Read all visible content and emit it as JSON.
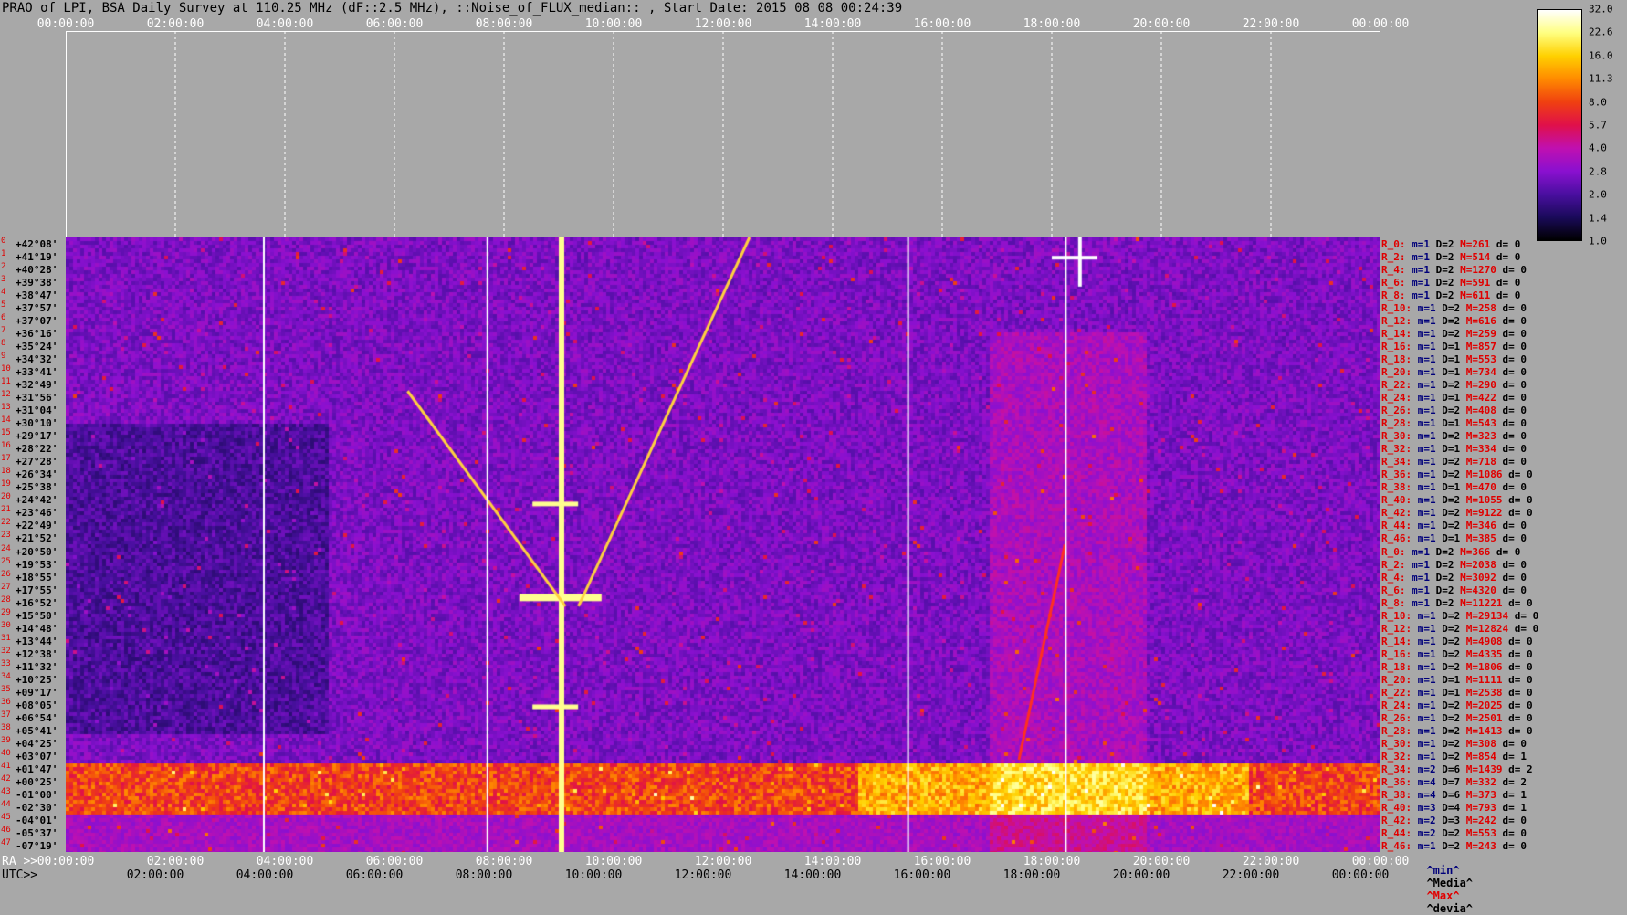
{
  "title": "PRAO of LPI, BSA Daily Survey at 110.25 MHz (dF::2.5 MHz), ::Noise_of_FLUX_median:: , Start Date: 2015 08 08 00:24:39",
  "top_axis_ticks": [
    "00:00:00",
    "02:00:00",
    "04:00:00",
    "06:00:00",
    "08:00:00",
    "10:00:00",
    "12:00:00",
    "14:00:00",
    "16:00:00",
    "18:00:00",
    "20:00:00",
    "22:00:00",
    "00:00:00"
  ],
  "ra_axis_label": "RA >>",
  "ra_axis_ticks": [
    "00:00:00",
    "02:00:00",
    "04:00:00",
    "06:00:00",
    "08:00:00",
    "10:00:00",
    "12:00:00",
    "14:00:00",
    "16:00:00",
    "18:00:00",
    "20:00:00",
    "22:00:00",
    "00:00:00"
  ],
  "utc_axis_label": "UTC>>",
  "utc_axis_ticks": [
    "02:00:00",
    "04:00:00",
    "06:00:00",
    "08:00:00",
    "10:00:00",
    "12:00:00",
    "14:00:00",
    "16:00:00",
    "18:00:00",
    "20:00:00",
    "22:00:00",
    "00:00:00"
  ],
  "declinations": [
    "+42°08'",
    "+41°19'",
    "+40°28'",
    "+39°38'",
    "+38°47'",
    "+37°57'",
    "+37°07'",
    "+36°16'",
    "+35°24'",
    "+34°32'",
    "+33°41'",
    "+32°49'",
    "+31°56'",
    "+31°04'",
    "+30°10'",
    "+29°17'",
    "+28°22'",
    "+27°28'",
    "+26°34'",
    "+25°38'",
    "+24°42'",
    "+23°46'",
    "+22°49'",
    "+21°52'",
    "+20°50'",
    "+19°53'",
    "+18°55'",
    "+17°55'",
    "+16°52'",
    "+15°50'",
    "+14°48'",
    "+13°44'",
    "+12°38'",
    "+11°32'",
    "+10°25'",
    "+09°17'",
    "+08°05'",
    "+06°54'",
    "+05°41'",
    "+04°25'",
    "+03°07'",
    "+01°47'",
    "+00°25'",
    "-01°00'",
    "-02°30'",
    "-04°01'",
    "-05°37'",
    "-07°19'"
  ],
  "row_stats": [
    [
      "R_0:",
      "m=1",
      "D=2",
      "M=261",
      "d= 0"
    ],
    [
      "R_2:",
      "m=1",
      "D=2",
      "M=514",
      "d= 0"
    ],
    [
      "R_4:",
      "m=1",
      "D=2",
      "M=1270",
      "d= 0"
    ],
    [
      "R_6:",
      "m=1",
      "D=2",
      "M=591",
      "d= 0"
    ],
    [
      "R_8:",
      "m=1",
      "D=2",
      "M=611",
      "d= 0"
    ],
    [
      "R_10:",
      "m=1",
      "D=2",
      "M=258",
      "d= 0"
    ],
    [
      "R_12:",
      "m=1",
      "D=2",
      "M=616",
      "d= 0"
    ],
    [
      "R_14:",
      "m=1",
      "D=2",
      "M=259",
      "d= 0"
    ],
    [
      "R_16:",
      "m=1",
      "D=1",
      "M=857",
      "d= 0"
    ],
    [
      "R_18:",
      "m=1",
      "D=1",
      "M=553",
      "d= 0"
    ],
    [
      "R_20:",
      "m=1",
      "D=1",
      "M=734",
      "d= 0"
    ],
    [
      "R_22:",
      "m=1",
      "D=2",
      "M=290",
      "d= 0"
    ],
    [
      "R_24:",
      "m=1",
      "D=1",
      "M=422",
      "d= 0"
    ],
    [
      "R_26:",
      "m=1",
      "D=2",
      "M=408",
      "d= 0"
    ],
    [
      "R_28:",
      "m=1",
      "D=1",
      "M=543",
      "d= 0"
    ],
    [
      "R_30:",
      "m=1",
      "D=2",
      "M=323",
      "d= 0"
    ],
    [
      "R_32:",
      "m=1",
      "D=1",
      "M=334",
      "d= 0"
    ],
    [
      "R_34:",
      "m=1",
      "D=2",
      "M=718",
      "d= 0"
    ],
    [
      "R_36:",
      "m=1",
      "D=2",
      "M=1086",
      "d= 0"
    ],
    [
      "R_38:",
      "m=1",
      "D=1",
      "M=470",
      "d= 0"
    ],
    [
      "R_40:",
      "m=1",
      "D=2",
      "M=1055",
      "d= 0"
    ],
    [
      "R_42:",
      "m=1",
      "D=2",
      "M=9122",
      "d= 0"
    ],
    [
      "R_44:",
      "m=1",
      "D=2",
      "M=346",
      "d= 0"
    ],
    [
      "R_46:",
      "m=1",
      "D=1",
      "M=385",
      "d= 0"
    ],
    [
      "R_0:",
      "m=1",
      "D=2",
      "M=366",
      "d= 0"
    ],
    [
      "R_2:",
      "m=1",
      "D=2",
      "M=2038",
      "d= 0"
    ],
    [
      "R_4:",
      "m=1",
      "D=2",
      "M=3092",
      "d= 0"
    ],
    [
      "R_6:",
      "m=1",
      "D=2",
      "M=4320",
      "d= 0"
    ],
    [
      "R_8:",
      "m=1",
      "D=2",
      "M=11221",
      "d= 0"
    ],
    [
      "R_10:",
      "m=1",
      "D=2",
      "M=29134",
      "d= 0"
    ],
    [
      "R_12:",
      "m=1",
      "D=2",
      "M=12824",
      "d= 0"
    ],
    [
      "R_14:",
      "m=1",
      "D=2",
      "M=4908",
      "d= 0"
    ],
    [
      "R_16:",
      "m=1",
      "D=2",
      "M=4335",
      "d= 0"
    ],
    [
      "R_18:",
      "m=1",
      "D=2",
      "M=1806",
      "d= 0"
    ],
    [
      "R_20:",
      "m=1",
      "D=1",
      "M=1111",
      "d= 0"
    ],
    [
      "R_22:",
      "m=1",
      "D=1",
      "M=2538",
      "d= 0"
    ],
    [
      "R_24:",
      "m=1",
      "D=2",
      "M=2025",
      "d= 0"
    ],
    [
      "R_26:",
      "m=1",
      "D=2",
      "M=2501",
      "d= 0"
    ],
    [
      "R_28:",
      "m=1",
      "D=2",
      "M=1413",
      "d= 0"
    ],
    [
      "R_30:",
      "m=1",
      "D=2",
      "M=308",
      "d= 0"
    ],
    [
      "R_32:",
      "m=1",
      "D=2",
      "M=854",
      "d= 1"
    ],
    [
      "R_34:",
      "m=2",
      "D=6",
      "M=1439",
      "d= 2"
    ],
    [
      "R_36:",
      "m=4",
      "D=7",
      "M=332",
      "d= 2"
    ],
    [
      "R_38:",
      "m=4",
      "D=6",
      "M=373",
      "d= 1"
    ],
    [
      "R_40:",
      "m=3",
      "D=4",
      "M=793",
      "d= 1"
    ],
    [
      "R_42:",
      "m=2",
      "D=3",
      "M=242",
      "d= 0"
    ],
    [
      "R_44:",
      "m=2",
      "D=2",
      "M=553",
      "d= 0"
    ],
    [
      "R_46:",
      "m=1",
      "D=2",
      "M=243",
      "d= 0"
    ]
  ],
  "stat_legend": {
    "min": "^min^",
    "median": "^Media^",
    "max": "^Max^",
    "dev": "^devia^"
  },
  "colorbar": {
    "ticks": [
      "32.0",
      "22.6",
      "16.0",
      "11.3",
      "8.0",
      "5.7",
      "4.0",
      "2.8",
      "2.0",
      "1.4",
      "1.0"
    ],
    "colors": [
      "#000000",
      "#1a0a5a",
      "#4a0fa0",
      "#8a10d0",
      "#c010b0",
      "#e0104a",
      "#f04010",
      "#ff8a00",
      "#ffd000",
      "#ffff80",
      "#ffffff"
    ]
  },
  "colors": {
    "background": "#a8a8a8",
    "accent_red": "#e00000",
    "dark_blue": "#00007a"
  }
}
